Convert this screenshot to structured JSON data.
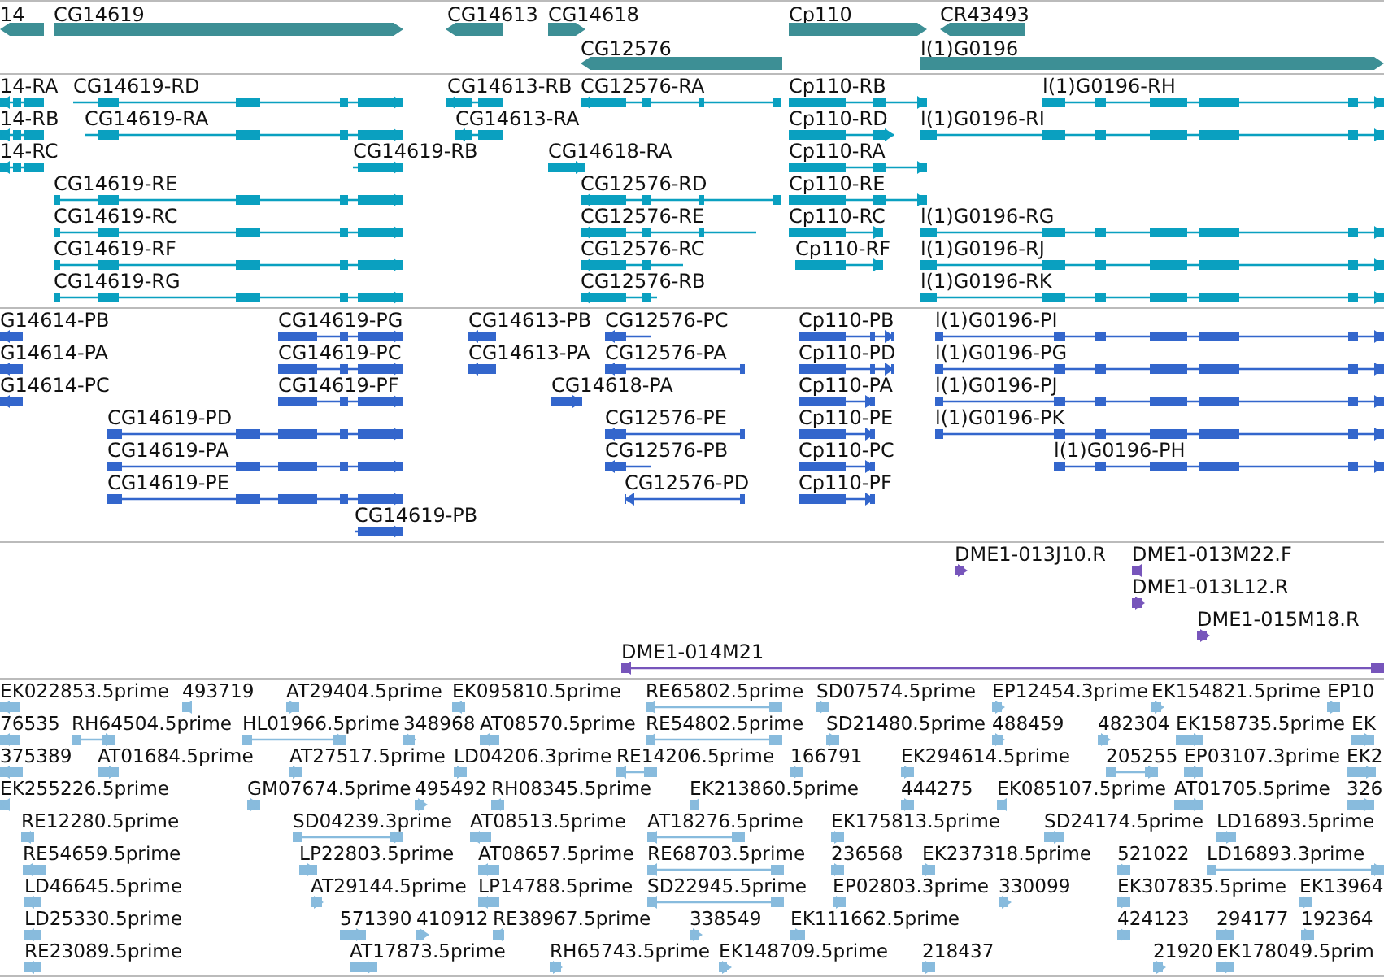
{
  "tracks": [
    {
      "kind": "gene",
      "features": [
        {
          "label": "14",
          "reverse": true
        },
        {
          "label": "CG14619",
          "reverse": false
        },
        {
          "label": "CG14613",
          "reverse": true
        },
        {
          "label": "CG14618",
          "reverse": false
        },
        {
          "label": "Cp110",
          "reverse": false
        },
        {
          "label": "CR43493",
          "reverse": true
        },
        {
          "label": "CG12576",
          "reverse": true
        },
        {
          "label": "l(1)G0196",
          "reverse": false
        }
      ]
    },
    {
      "kind": "transcript",
      "features": [
        {
          "label": "14-RA",
          "reverse": true
        },
        {
          "label": "CG14619-RD",
          "reverse": false
        },
        {
          "label": "CG14613-RB",
          "reverse": true
        },
        {
          "label": "CG12576-RA",
          "reverse": true
        },
        {
          "label": "Cp110-RB",
          "reverse": false
        },
        {
          "label": "l(1)G0196-RH",
          "reverse": false
        },
        {
          "label": "14-RB",
          "reverse": true
        },
        {
          "label": "CG14619-RA",
          "reverse": false
        },
        {
          "label": "CG14613-RA",
          "reverse": true
        },
        {
          "label": "Cp110-RD",
          "reverse": false
        },
        {
          "label": "l(1)G0196-RI",
          "reverse": false
        },
        {
          "label": "14-RC",
          "reverse": true
        },
        {
          "label": "CG14619-RB",
          "reverse": false
        },
        {
          "label": "CG14618-RA",
          "reverse": false
        },
        {
          "label": "Cp110-RA",
          "reverse": false
        },
        {
          "label": "CG14619-RE",
          "reverse": false
        },
        {
          "label": "CG12576-RD",
          "reverse": true
        },
        {
          "label": "Cp110-RE",
          "reverse": false
        },
        {
          "label": "CG14619-RC",
          "reverse": false
        },
        {
          "label": "CG12576-RE",
          "reverse": true
        },
        {
          "label": "Cp110-RC",
          "reverse": false
        },
        {
          "label": "l(1)G0196-RG",
          "reverse": false
        },
        {
          "label": "CG14619-RF",
          "reverse": false
        },
        {
          "label": "CG12576-RC",
          "reverse": true
        },
        {
          "label": "Cp110-RF",
          "reverse": false
        },
        {
          "label": "l(1)G0196-RJ",
          "reverse": false
        },
        {
          "label": "CG14619-RG",
          "reverse": false
        },
        {
          "label": "CG12576-RB",
          "reverse": true
        },
        {
          "label": "l(1)G0196-RK",
          "reverse": false
        }
      ]
    },
    {
      "kind": "protein",
      "features": [
        {
          "label": "G14614-PB",
          "reverse": true
        },
        {
          "label": "CG14619-PG",
          "reverse": false
        },
        {
          "label": "CG14613-PB",
          "reverse": true
        },
        {
          "label": "CG12576-PC",
          "reverse": true
        },
        {
          "label": "Cp110-PB",
          "reverse": false
        },
        {
          "label": "l(1)G0196-PI",
          "reverse": false
        },
        {
          "label": "G14614-PA",
          "reverse": true
        },
        {
          "label": "CG14619-PC",
          "reverse": false
        },
        {
          "label": "CG14613-PA",
          "reverse": true
        },
        {
          "label": "CG12576-PA",
          "reverse": true
        },
        {
          "label": "Cp110-PD",
          "reverse": false
        },
        {
          "label": "l(1)G0196-PG",
          "reverse": false
        },
        {
          "label": "G14614-PC",
          "reverse": true
        },
        {
          "label": "CG14619-PF",
          "reverse": false
        },
        {
          "label": "CG14618-PA",
          "reverse": false
        },
        {
          "label": "Cp110-PA",
          "reverse": false
        },
        {
          "label": "l(1)G0196-PJ",
          "reverse": false
        },
        {
          "label": "CG14619-PD",
          "reverse": false
        },
        {
          "label": "CG12576-PE",
          "reverse": true
        },
        {
          "label": "Cp110-PE",
          "reverse": false
        },
        {
          "label": "l(1)G0196-PK",
          "reverse": false
        },
        {
          "label": "CG14619-PA",
          "reverse": false
        },
        {
          "label": "CG12576-PB",
          "reverse": true
        },
        {
          "label": "Cp110-PC",
          "reverse": false
        },
        {
          "label": "l(1)G0196-PH",
          "reverse": false
        },
        {
          "label": "CG14619-PE",
          "reverse": false
        },
        {
          "label": "CG12576-PD",
          "reverse": true
        },
        {
          "label": "Cp110-PF",
          "reverse": false
        },
        {
          "label": "CG14619-PB",
          "reverse": false
        }
      ]
    },
    {
      "kind": "clone-end",
      "features": [
        {
          "label": "DME1-013J10.R",
          "reverse": false
        },
        {
          "label": "DME1-013M22.F",
          "reverse": true
        },
        {
          "label": "DME1-013L12.R",
          "reverse": false
        },
        {
          "label": "DME1-015M18.R",
          "reverse": false
        },
        {
          "label": "DME1-014M21",
          "reverse": true
        }
      ]
    },
    {
      "kind": "est",
      "features": [
        {
          "label": "EK022853.5prime",
          "reverse": true
        },
        {
          "label": "493719",
          "reverse": true
        },
        {
          "label": "AT29404.5prime",
          "reverse": false
        },
        {
          "label": "EK095810.5prime",
          "reverse": true
        },
        {
          "label": "RE65802.5prime",
          "reverse": true
        },
        {
          "label": "SD07574.5prime",
          "reverse": false
        },
        {
          "label": "EP12454.3prime",
          "reverse": false
        },
        {
          "label": "EK154821.5prime",
          "reverse": false
        },
        {
          "label": "EP10",
          "reverse": false
        },
        {
          "label": "76535",
          "reverse": true
        },
        {
          "label": "RH64504.5prime",
          "reverse": false
        },
        {
          "label": "HL01966.5prime",
          "reverse": false
        },
        {
          "label": "348968",
          "reverse": false
        },
        {
          "label": "AT08570.5prime",
          "reverse": true
        },
        {
          "label": "RE54802.5prime",
          "reverse": true
        },
        {
          "label": "SD21480.5prime",
          "reverse": false
        },
        {
          "label": "488459",
          "reverse": false
        },
        {
          "label": "482304",
          "reverse": false
        },
        {
          "label": "EK158735.5prime",
          "reverse": false
        },
        {
          "label": "EK",
          "reverse": false
        },
        {
          "label": "375389",
          "reverse": true
        },
        {
          "label": "AT01684.5prime",
          "reverse": false
        },
        {
          "label": "AT27517.5prime",
          "reverse": false
        },
        {
          "label": "LD04206.3prime",
          "reverse": false
        },
        {
          "label": "RE14206.5prime",
          "reverse": true
        },
        {
          "label": "166791",
          "reverse": false
        },
        {
          "label": "EK294614.5prime",
          "reverse": false
        },
        {
          "label": "205255",
          "reverse": false
        },
        {
          "label": "EP03107.3prime",
          "reverse": false
        },
        {
          "label": "EK2",
          "reverse": false
        },
        {
          "label": "EK255226.5prime",
          "reverse": true
        },
        {
          "label": "GM07674.5prime",
          "reverse": false
        },
        {
          "label": "495492",
          "reverse": false
        },
        {
          "label": "RH08345.5prime",
          "reverse": true
        },
        {
          "label": "EK213860.5prime",
          "reverse": true
        },
        {
          "label": "444275",
          "reverse": false
        },
        {
          "label": "EK085107.5prime",
          "reverse": true
        },
        {
          "label": "AT01705.5prime",
          "reverse": false
        },
        {
          "label": "326",
          "reverse": false
        },
        {
          "label": "RE12280.5prime",
          "reverse": true
        },
        {
          "label": "SD04239.3prime",
          "reverse": false
        },
        {
          "label": "AT08513.5prime",
          "reverse": true
        },
        {
          "label": "AT18276.5prime",
          "reverse": true
        },
        {
          "label": "EK175813.5prime",
          "reverse": false
        },
        {
          "label": "SD24174.5prime",
          "reverse": false
        },
        {
          "label": "LD16893.5prime",
          "reverse": false
        },
        {
          "label": "RE54659.5prime",
          "reverse": true
        },
        {
          "label": "LP22803.5prime",
          "reverse": false
        },
        {
          "label": "AT08657.5prime",
          "reverse": true
        },
        {
          "label": "RE68703.5prime",
          "reverse": true
        },
        {
          "label": "236568",
          "reverse": false
        },
        {
          "label": "EK237318.5prime",
          "reverse": false
        },
        {
          "label": "521022",
          "reverse": false
        },
        {
          "label": "LD16893.3prime",
          "reverse": false
        },
        {
          "label": "LD46645.5prime",
          "reverse": true
        },
        {
          "label": "AT29144.5prime",
          "reverse": false
        },
        {
          "label": "LP14788.5prime",
          "reverse": true
        },
        {
          "label": "SD22945.5prime",
          "reverse": true
        },
        {
          "label": "EP02803.3prime",
          "reverse": false
        },
        {
          "label": "330099",
          "reverse": false
        },
        {
          "label": "EK307835.5prime",
          "reverse": false
        },
        {
          "label": "EK13964",
          "reverse": false
        },
        {
          "label": "LD25330.5prime",
          "reverse": true
        },
        {
          "label": "571390",
          "reverse": false
        },
        {
          "label": "410912",
          "reverse": false
        },
        {
          "label": "RE38967.5prime",
          "reverse": true
        },
        {
          "label": "338549",
          "reverse": false
        },
        {
          "label": "EK111662.5prime",
          "reverse": false
        },
        {
          "label": "424123",
          "reverse": false
        },
        {
          "label": "294177",
          "reverse": false
        },
        {
          "label": "192364",
          "reverse": false
        },
        {
          "label": "RE23089.5prime",
          "reverse": true
        },
        {
          "label": "AT17873.5prime",
          "reverse": false
        },
        {
          "label": "RH65743.5prime",
          "reverse": false
        },
        {
          "label": "EK148709.5prime",
          "reverse": false
        },
        {
          "label": "218437",
          "reverse": false
        },
        {
          "label": "21920",
          "reverse": false
        },
        {
          "label": "EK178049.5prim",
          "reverse": false
        }
      ]
    }
  ]
}
